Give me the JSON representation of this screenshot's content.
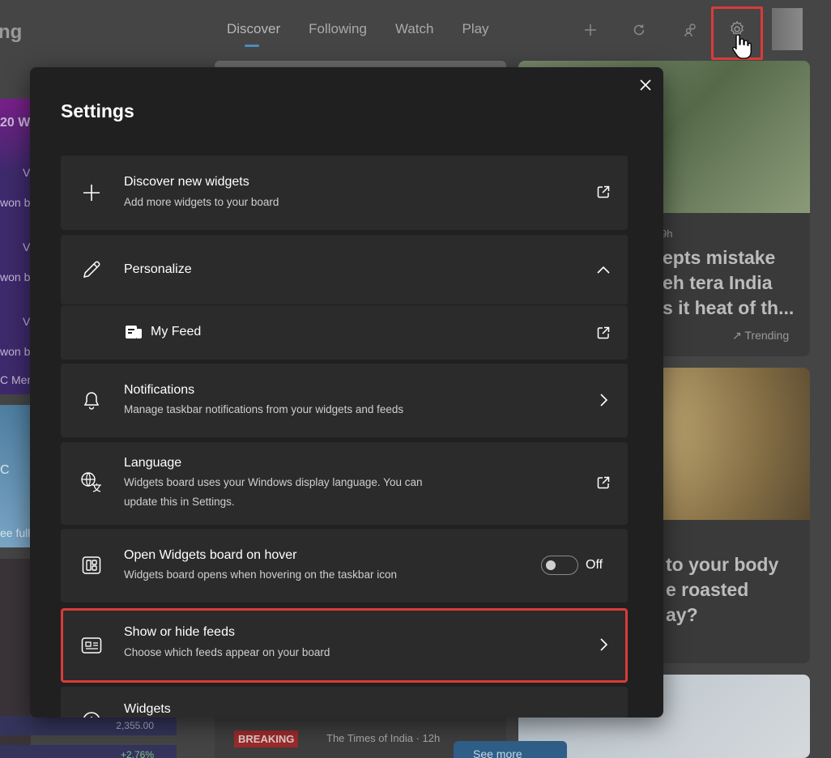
{
  "background": {
    "brand_fragment": "ng",
    "tabs": [
      "Discover",
      "Following",
      "Watch",
      "Play"
    ],
    "left_fragments": [
      "20 Wo",
      "V",
      "won b",
      "V",
      "won b",
      "V",
      "won b",
      "C Men",
      "C",
      "ee full"
    ],
    "stock_values": [
      "2,355.00",
      "+2.76%"
    ],
    "card_right_top": {
      "meta": "9h",
      "headline_lines": [
        "epts mistake",
        "eh tera India",
        "s it heat of th..."
      ],
      "trend_label": "Trending"
    },
    "card_right_mid": {
      "headline_lines": [
        "to your body",
        "e roasted",
        "ay?"
      ]
    },
    "breaking_tag": "BREAKING",
    "breaking_source": "The Times of India · 12h",
    "see_more": "See more"
  },
  "settings": {
    "title": "Settings",
    "rows": {
      "discover": {
        "title": "Discover new widgets",
        "subtitle": "Add more widgets to your board"
      },
      "personalize": {
        "title": "Personalize"
      },
      "my_feed": {
        "title": "My Feed"
      },
      "notifications": {
        "title": "Notifications",
        "subtitle": "Manage taskbar notifications from your widgets and feeds"
      },
      "language": {
        "title": "Language",
        "subtitle_line1": "Widgets board uses your Windows display language. You can",
        "subtitle_line2": "update this in Settings."
      },
      "hover": {
        "title": "Open Widgets board on hover",
        "subtitle": "Widgets board opens when hovering on the taskbar icon",
        "toggle_state": "Off"
      },
      "feeds": {
        "title": "Show or hide feeds",
        "subtitle": "Choose which feeds appear on your board"
      },
      "widgets": {
        "title": "Widgets"
      }
    }
  },
  "colors": {
    "highlight": "#d93b3b",
    "modal_bg": "#202020",
    "row_bg": "#2b2b2b",
    "accent": "#4c8dbd"
  }
}
